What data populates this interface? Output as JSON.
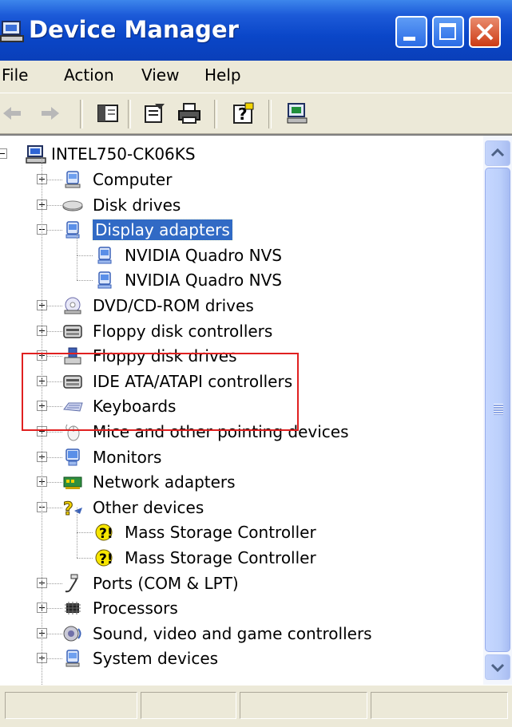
{
  "window": {
    "title": "Device Manager"
  },
  "menu": {
    "items": [
      "File",
      "Action",
      "View",
      "Help"
    ]
  },
  "tree": {
    "root": "INTEL750-CK06KS",
    "items": [
      {
        "label": "Computer",
        "icon": "computer-icon"
      },
      {
        "label": "Disk drives",
        "icon": "disk-drive-icon"
      },
      {
        "label": "Display adapters",
        "icon": "display-adapter-icon",
        "expanded": true,
        "selected": true
      },
      {
        "label": "NVIDIA Quadro NVS",
        "icon": "display-adapter-icon",
        "child": true
      },
      {
        "label": "NVIDIA Quadro NVS",
        "icon": "display-adapter-icon",
        "child": true
      },
      {
        "label": "DVD/CD-ROM drives",
        "icon": "cd-drive-icon"
      },
      {
        "label": "Floppy disk controllers",
        "icon": "controller-icon"
      },
      {
        "label": "Floppy disk drives",
        "icon": "floppy-drive-icon"
      },
      {
        "label": "IDE ATA/ATAPI controllers",
        "icon": "controller-icon"
      },
      {
        "label": "Keyboards",
        "icon": "keyboard-icon"
      },
      {
        "label": "Mice and other pointing devices",
        "icon": "mouse-icon"
      },
      {
        "label": "Monitors",
        "icon": "monitor-icon"
      },
      {
        "label": "Network adapters",
        "icon": "network-adapter-icon"
      },
      {
        "label": "Other devices",
        "icon": "unknown-device-icon",
        "expanded": true
      },
      {
        "label": "Mass Storage Controller",
        "icon": "warning-device-icon",
        "child": true
      },
      {
        "label": "Mass Storage Controller",
        "icon": "warning-device-icon",
        "child": true
      },
      {
        "label": "Ports (COM & LPT)",
        "icon": "port-icon"
      },
      {
        "label": "Processors",
        "icon": "processor-icon"
      },
      {
        "label": "Sound, video and game controllers",
        "icon": "sound-icon"
      },
      {
        "label": "System devices",
        "icon": "system-device-icon"
      }
    ]
  },
  "colors": {
    "title_bar": "#0a46c8",
    "selection": "#316ac5",
    "highlight_box": "#e02020",
    "chrome": "#ece9d8"
  }
}
